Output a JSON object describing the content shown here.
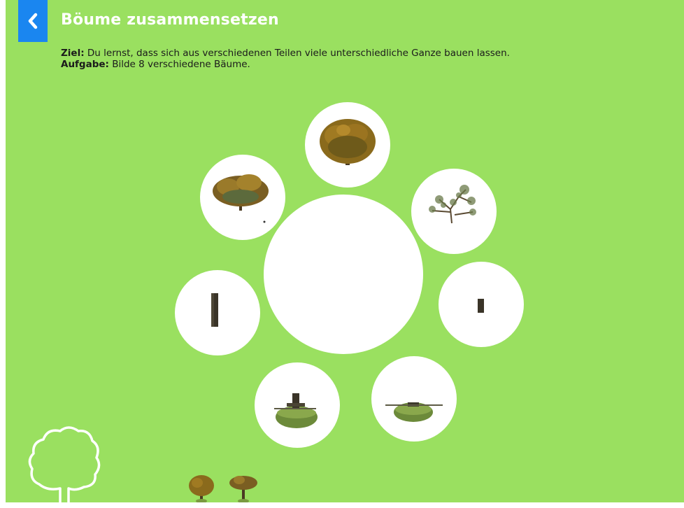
{
  "header": {
    "title": "Böume zusammensetzen",
    "back_icon": "chevron-left-icon"
  },
  "instructions": {
    "goal_label": "Ziel:",
    "goal_text": " Du lernst, dass sich aus verschiedenen Teilen viele unterschiedliche Ganze bauen lassen.",
    "task_label": "Aufgabe:",
    "task_text": " Bilde 8 verschiedene Bäume."
  },
  "slots": [
    {
      "part": "crown-round-autumn"
    },
    {
      "part": "crown-bare-sparse"
    },
    {
      "part": "trunk-short"
    },
    {
      "part": "ground-flat"
    },
    {
      "part": "ground-with-trunk-base"
    },
    {
      "part": "trunk-tall"
    },
    {
      "part": "crown-wide-autumn"
    }
  ],
  "builder": {
    "state": "empty"
  },
  "built_trees": {
    "count": 2
  },
  "colors": {
    "background": "#9ae060",
    "accent": "#1a86f0",
    "slot": "#ffffff"
  }
}
